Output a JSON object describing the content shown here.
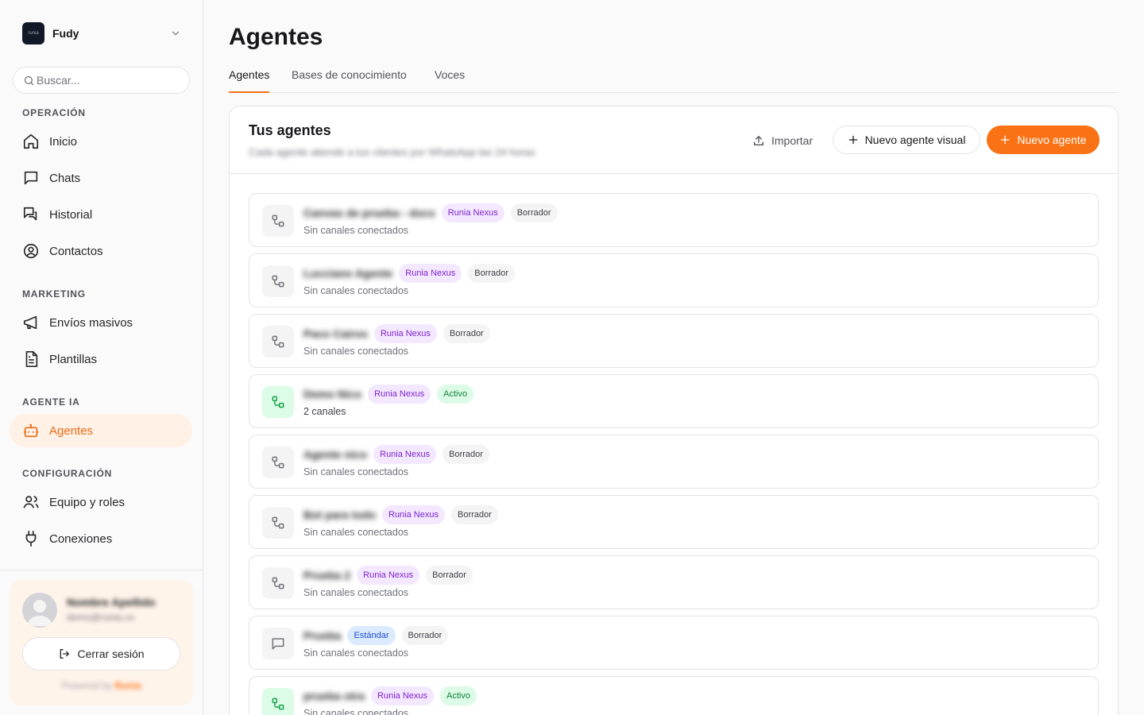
{
  "org": {
    "name": "Fudy",
    "logo_text": "runia"
  },
  "search": {
    "placeholder": "Buscar..."
  },
  "sections": {
    "operacion": "OPERACIÓN",
    "marketing": "MARKETING",
    "agente_ia": "AGENTE IA",
    "configuracion": "CONFIGURACIÓN"
  },
  "nav": {
    "inicio": "Inicio",
    "chats": "Chats",
    "historial": "Historial",
    "contactos": "Contactos",
    "envios": "Envíos masivos",
    "plantillas": "Plantillas",
    "agentes": "Agentes",
    "equipo": "Equipo y roles",
    "conexiones": "Conexiones"
  },
  "user": {
    "name": "Nombre Apellido",
    "email": "demo@runia.co",
    "logout_label": "Cerrar sesión",
    "powered_prefix": "Powered by",
    "powered_brand": "Runia"
  },
  "page": {
    "title": "Agentes"
  },
  "tabs": [
    {
      "label": "Agentes",
      "active": true
    },
    {
      "label": "Bases de conocimiento",
      "active": false
    },
    {
      "label": "Voces",
      "active": false
    }
  ],
  "panel": {
    "title": "Tus agentes",
    "subtitle": "Cada agente atiende a tus clientes por WhatsApp las 24 horas",
    "import_label": "Importar",
    "visual_label": "Nuevo agente visual",
    "new_label": "Nuevo agente"
  },
  "colors": {
    "accent": "#f97316",
    "active_nav_bg": "#fff1e6"
  },
  "agents": [
    {
      "name": "Canvas de prueba - docs",
      "type": "Runia Nexus",
      "type_kind": "nexus",
      "status": "Borrador",
      "status_kind": "draft",
      "channels": "Sin canales conectados",
      "icon": "flow-icon"
    },
    {
      "name": "Lucciano Agente",
      "type": "Runia Nexus",
      "type_kind": "nexus",
      "status": "Borrador",
      "status_kind": "draft",
      "channels": "Sin canales conectados",
      "icon": "flow-icon"
    },
    {
      "name": "Paco Cairos",
      "type": "Runia Nexus",
      "type_kind": "nexus",
      "status": "Borrador",
      "status_kind": "draft",
      "channels": "Sin canales conectados",
      "icon": "flow-icon"
    },
    {
      "name": "Demo Nico",
      "type": "Runia Nexus",
      "type_kind": "nexus",
      "status": "Activo",
      "status_kind": "active",
      "channels": "2 canales",
      "icon": "flow-icon"
    },
    {
      "name": "Agente nico",
      "type": "Runia Nexus",
      "type_kind": "nexus",
      "status": "Borrador",
      "status_kind": "draft",
      "channels": "Sin canales conectados",
      "icon": "flow-icon"
    },
    {
      "name": "Bot para todo",
      "type": "Runia Nexus",
      "type_kind": "nexus",
      "status": "Borrador",
      "status_kind": "draft",
      "channels": "Sin canales conectados",
      "icon": "flow-icon"
    },
    {
      "name": "Prueba 2",
      "type": "Runia Nexus",
      "type_kind": "nexus",
      "status": "Borrador",
      "status_kind": "draft",
      "channels": "Sin canales conectados",
      "icon": "flow-icon"
    },
    {
      "name": "Prueba",
      "type": "Estándar",
      "type_kind": "std",
      "status": "Borrador",
      "status_kind": "draft",
      "channels": "Sin canales conectados",
      "icon": "chat-icon"
    },
    {
      "name": "prueba otra",
      "type": "Runia Nexus",
      "type_kind": "nexus",
      "status": "Activo",
      "status_kind": "active",
      "channels": "Sin canales conectados",
      "icon": "flow-icon"
    }
  ]
}
